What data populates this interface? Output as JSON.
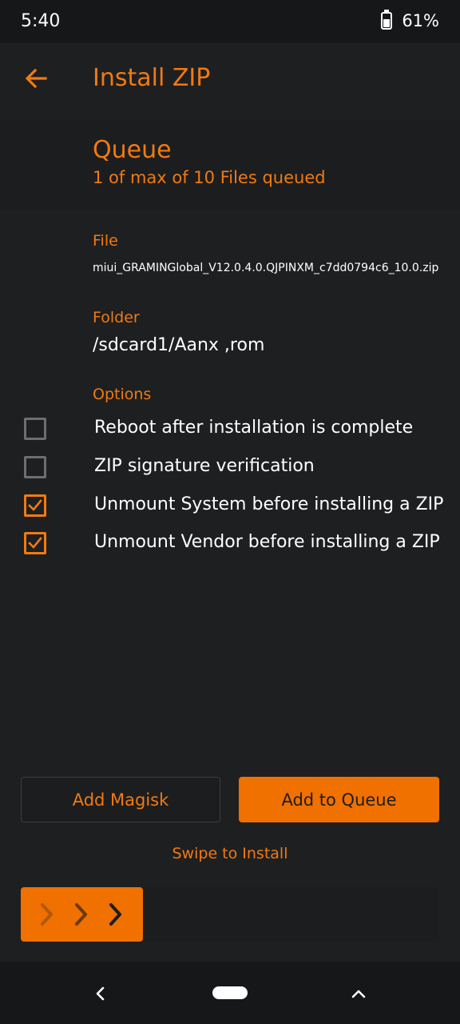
{
  "status_bar": {
    "time": "5:40",
    "battery_percent": "61%",
    "battery_level": 0.61
  },
  "header": {
    "title": "Install ZIP"
  },
  "queue": {
    "title": "Queue",
    "subtitle": "1 of max of 10 Files queued"
  },
  "file": {
    "label": "File",
    "value": "miui_GRAMINGlobal_V12.0.4.0.QJPINXM_c7dd0794c6_10.0.zip"
  },
  "folder": {
    "label": "Folder",
    "value": "/sdcard1/Aanx ,rom"
  },
  "options": {
    "label": "Options",
    "items": [
      {
        "label": "Reboot after installation is complete",
        "checked": false
      },
      {
        "label": "ZIP signature verification",
        "checked": false
      },
      {
        "label": "Unmount System before installing a ZIP",
        "checked": true
      },
      {
        "label": "Unmount Vendor before installing a ZIP",
        "checked": true
      }
    ]
  },
  "buttons": {
    "add_magisk": "Add Magisk",
    "add_to_queue": "Add to Queue"
  },
  "swipe": {
    "label": "Swipe to Install"
  },
  "icons": {
    "back": "arrow-left-icon",
    "swipe_handle": "chevrons-right-icon",
    "nav_back": "chevron-left-icon",
    "nav_recents": "chevron-up-icon"
  },
  "colors": {
    "accent": "#f07a13",
    "button_fill": "#f07000",
    "background": "#1e1f21"
  }
}
